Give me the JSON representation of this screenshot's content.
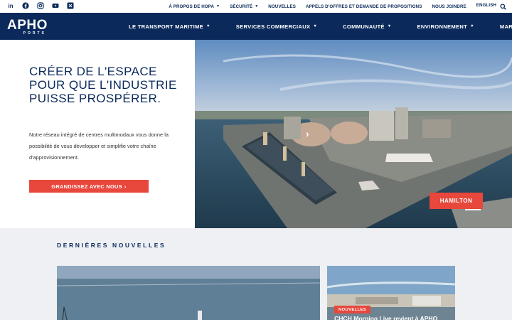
{
  "social": {
    "icons": [
      "linkedin-icon",
      "facebook-icon",
      "instagram-icon",
      "youtube-icon",
      "x-icon"
    ],
    "linkedin_label": "in"
  },
  "utility_nav": {
    "items": [
      {
        "label": "À PROPOS DE HOPA",
        "dropdown": true
      },
      {
        "label": "SÉCURITÉ",
        "dropdown": true
      },
      {
        "label": "NOUVELLES",
        "dropdown": false
      },
      {
        "label": "APPELS D'OFFRES ET DEMANDE DE PROPOSITIONS",
        "dropdown": false
      },
      {
        "label": "NOUS JOINDRE",
        "dropdown": false
      }
    ],
    "language": "ENGLISH",
    "search_icon": "search-icon"
  },
  "logo": {
    "main": "APHO",
    "sub": "PORTS"
  },
  "main_nav": {
    "items": [
      {
        "label": "LE TRANSPORT MARITIME",
        "dropdown": true
      },
      {
        "label": "SERVICES COMMERCIAUX",
        "dropdown": true
      },
      {
        "label": "COMMUNAUTÉ",
        "dropdown": true
      },
      {
        "label": "ENVIRONNEMENT",
        "dropdown": true
      },
      {
        "label": "MARINA",
        "dropdown": false
      }
    ]
  },
  "hero": {
    "title": "CRÉER DE L'ESPACE POUR QUE L'INDUSTRIE PUISSE PROSPÉRER.",
    "text": "Notre réseau intégré de centres multimodaux vous donne la possibilité de vous développer et simplifie votre chaîne d'approvisionnement.",
    "cta_label": "GRANDISSEZ AVEC NOUS",
    "cta_icon": "chevron-right-icon",
    "slide_label": "HAMILTON",
    "prev_icon": "chevron-left-icon",
    "next_icon": "chevron-right-icon"
  },
  "news": {
    "heading": "DERNIÈRES NOUVELLES",
    "card2_badge": "NOUVELLES",
    "card2_title": "CHCH Morning Live revient à APHO"
  },
  "colors": {
    "navy": "#0b2a5b",
    "accent": "#e8473c",
    "news_bg": "#eef0f3"
  }
}
